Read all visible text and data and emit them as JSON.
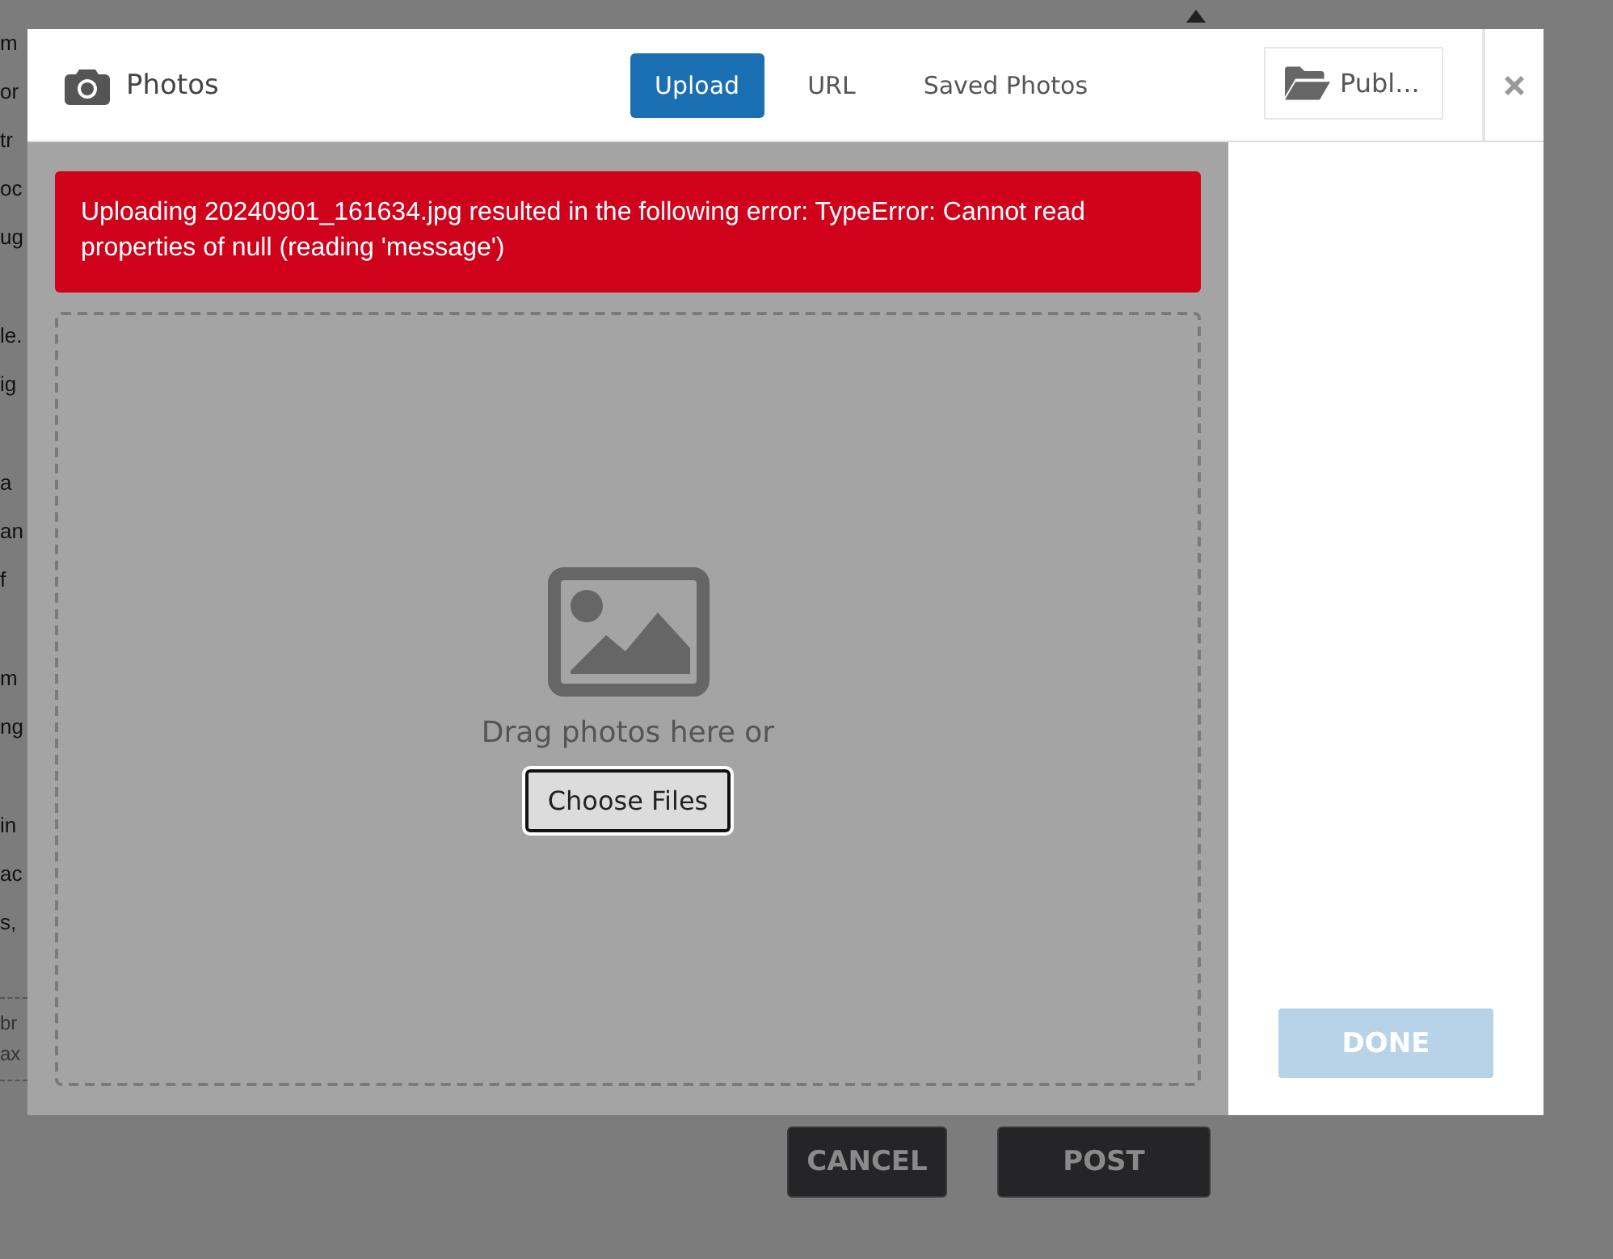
{
  "background": {
    "paragraphs": [
      [
        "m",
        "or",
        "tr",
        "oc",
        "ug"
      ],
      [
        "le.",
        "ig"
      ],
      [
        "a",
        "an",
        "f"
      ],
      [
        "m",
        "ng"
      ],
      [
        "in",
        "ac",
        "s,"
      ]
    ],
    "note": [
      "br",
      "ax"
    ],
    "buttons": [
      {
        "label": "CANCEL",
        "kind": "secondary"
      },
      {
        "label": "POST",
        "kind": "primary"
      }
    ]
  },
  "dialog": {
    "title": "Photos",
    "tabs": [
      {
        "label": "Upload",
        "selected": true
      },
      {
        "label": "URL",
        "selected": false
      },
      {
        "label": "Saved Photos",
        "selected": false
      }
    ],
    "album_button": "Publ...",
    "error": "Uploading 20240901_161634.jpg resulted in the following error: TypeError: Cannot read properties of null (reading 'message')",
    "dropzone": {
      "prompt": "Drag photos here or",
      "button": "Choose Files"
    },
    "done": {
      "label": "DONE",
      "disabled": true
    }
  }
}
